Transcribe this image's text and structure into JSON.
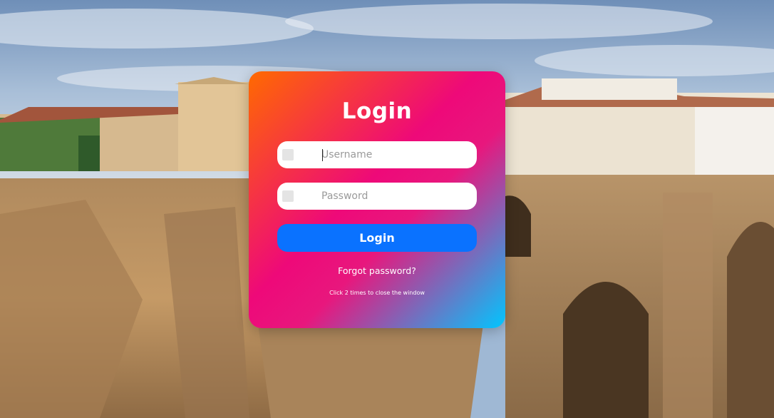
{
  "login_card": {
    "title": "Login",
    "username_placeholder": "Username",
    "password_placeholder": "Password",
    "login_button_label": "Login",
    "forgot_password_label": "Forgot password?",
    "close_hint": "Click 2 times to close the window"
  },
  "colors": {
    "gradient_start": "#ff6a00",
    "gradient_mid": "#ee0979",
    "gradient_end": "#00c6ff",
    "button": "#0a72ff"
  },
  "icons": {
    "username_field_icon": "user-icon",
    "password_field_icon": "lock-icon"
  }
}
